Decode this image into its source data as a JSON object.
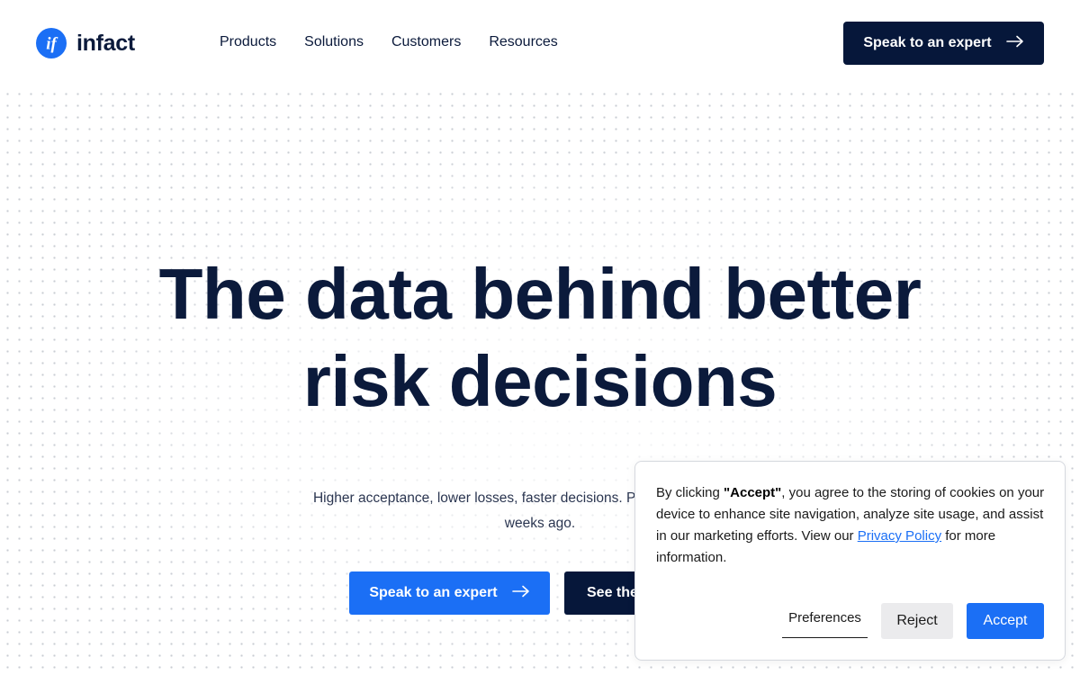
{
  "brand": {
    "name": "infact",
    "logo_icon": "if-monogram-icon",
    "accent_color": "#1b6ff5",
    "dark_color": "#06173a"
  },
  "nav": {
    "items": [
      {
        "label": "Products"
      },
      {
        "label": "Solutions"
      },
      {
        "label": "Customers"
      },
      {
        "label": "Resources"
      }
    ]
  },
  "header": {
    "cta_label": "Speak to an expert",
    "cta_icon": "arrow-right-icon"
  },
  "hero": {
    "title_line1": "The data behind better",
    "title_line2": "risk decisions",
    "subtitle_line1": "Higher acceptance, lower losses, faster decisions. Powered by data that r",
    "subtitle_line2": "weeks ago.",
    "primary_cta": "Speak to an expert",
    "primary_cta_icon": "arrow-right-icon",
    "secondary_cta": "See the"
  },
  "cookie": {
    "text_prefix": "By clicking ",
    "text_bold": "\"Accept\"",
    "text_middle": ", you agree to the storing of cookies on your device to enhance site navigation, analyze site usage, and assist in our marketing efforts. View our ",
    "link_label": "Privacy Policy",
    "text_suffix": " for more information.",
    "preferences_label": "Preferences",
    "reject_label": "Reject",
    "accept_label": "Accept"
  }
}
